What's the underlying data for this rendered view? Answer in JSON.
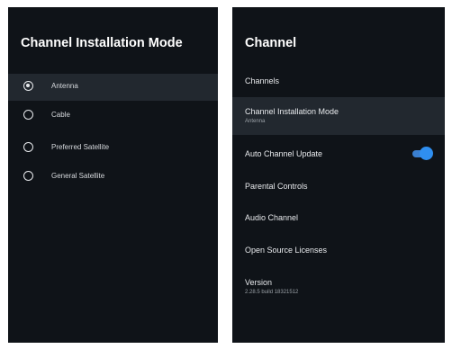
{
  "left_panel": {
    "title": "Channel Installation Mode",
    "options": [
      {
        "label": "Antenna",
        "selected": true
      },
      {
        "label": "Cable",
        "selected": false
      },
      {
        "label": "Preferred Satellite",
        "selected": false
      },
      {
        "label": "General Satellite",
        "selected": false
      }
    ]
  },
  "right_panel": {
    "title": "Channel",
    "items": [
      {
        "label": "Channels"
      },
      {
        "label": "Channel Installation Mode",
        "sub": "Antenna"
      },
      {
        "label": "Auto Channel Update",
        "toggle_on": true
      },
      {
        "label": "Parental Controls"
      },
      {
        "label": "Audio Channel"
      },
      {
        "label": "Open Source Licenses"
      },
      {
        "label": "Version",
        "sub": "2.28.5 build 18321512"
      }
    ]
  },
  "colors": {
    "panel_bg": "#0f1318",
    "highlight_bg": "#22282f",
    "toggle_accent": "#2f8ff0"
  }
}
